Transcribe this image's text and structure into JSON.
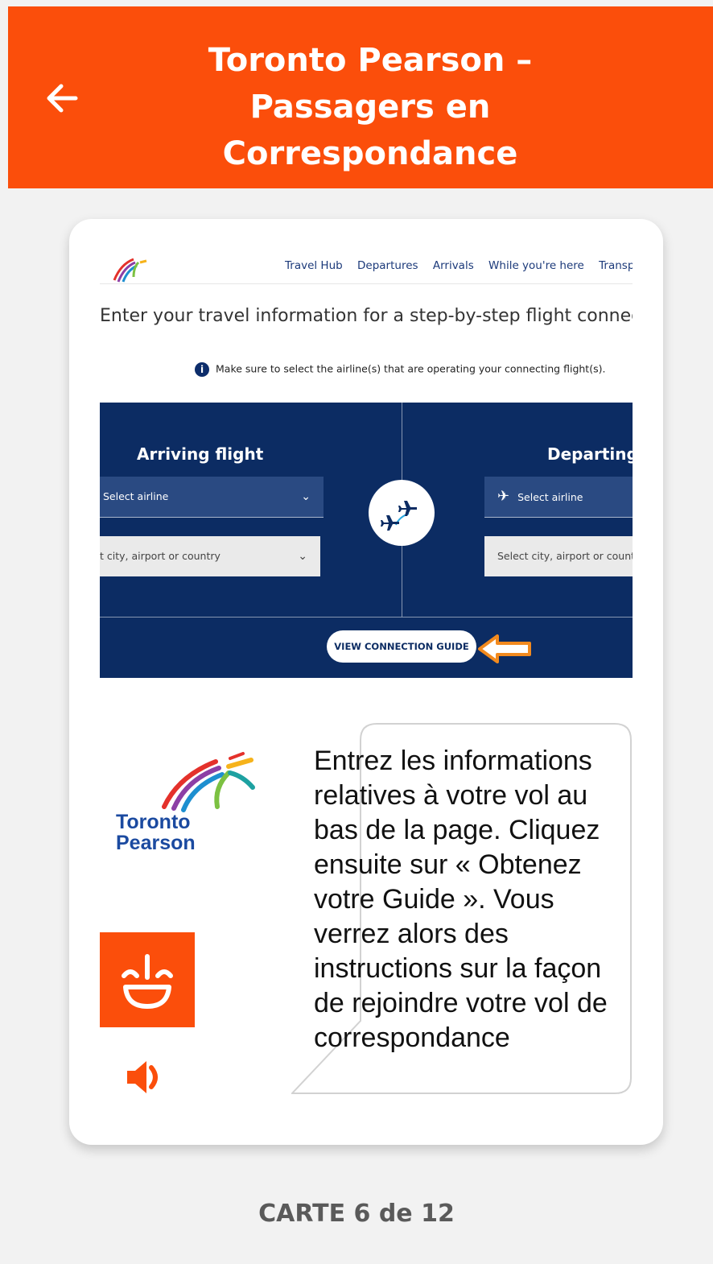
{
  "header": {
    "title_line1": "Toronto Pearson –",
    "title_line2": "Passagers en",
    "title_line3": "Correspondance",
    "back_icon": "arrow-left-icon",
    "background": "#fb4e0b"
  },
  "screenshot": {
    "nav": [
      "Travel Hub",
      "Departures",
      "Arrivals",
      "While you're here",
      "Transporta"
    ],
    "intro": "Enter your travel information for a step-by-step flight connectic",
    "notice": "Make sure to select the airline(s) that are operating your connecting flight(s).",
    "arriving_title": "Arriving flight",
    "departing_title": "Departing",
    "arr_airline_placeholder": "Select airline",
    "arr_city_placeholder": "t city, airport or country",
    "dep_airline_placeholder": "Select airline",
    "dep_city_placeholder": "Select city, airport or country",
    "guide_button": "VIEW CONNECTION GUIDE",
    "panel_color": "#0c2c63"
  },
  "logo": {
    "line1": "Toronto",
    "line2": "Pearson"
  },
  "bubble": {
    "text": "Entrez les informations relatives à votre vol au bas de la page. Cliquez ensuite sur « Obtenez votre Guide ». Vous verrez alors des instructions sur la façon de rejoindre votre vol de correspondance"
  },
  "footer": {
    "counter": "CARTE 6 de 12"
  }
}
